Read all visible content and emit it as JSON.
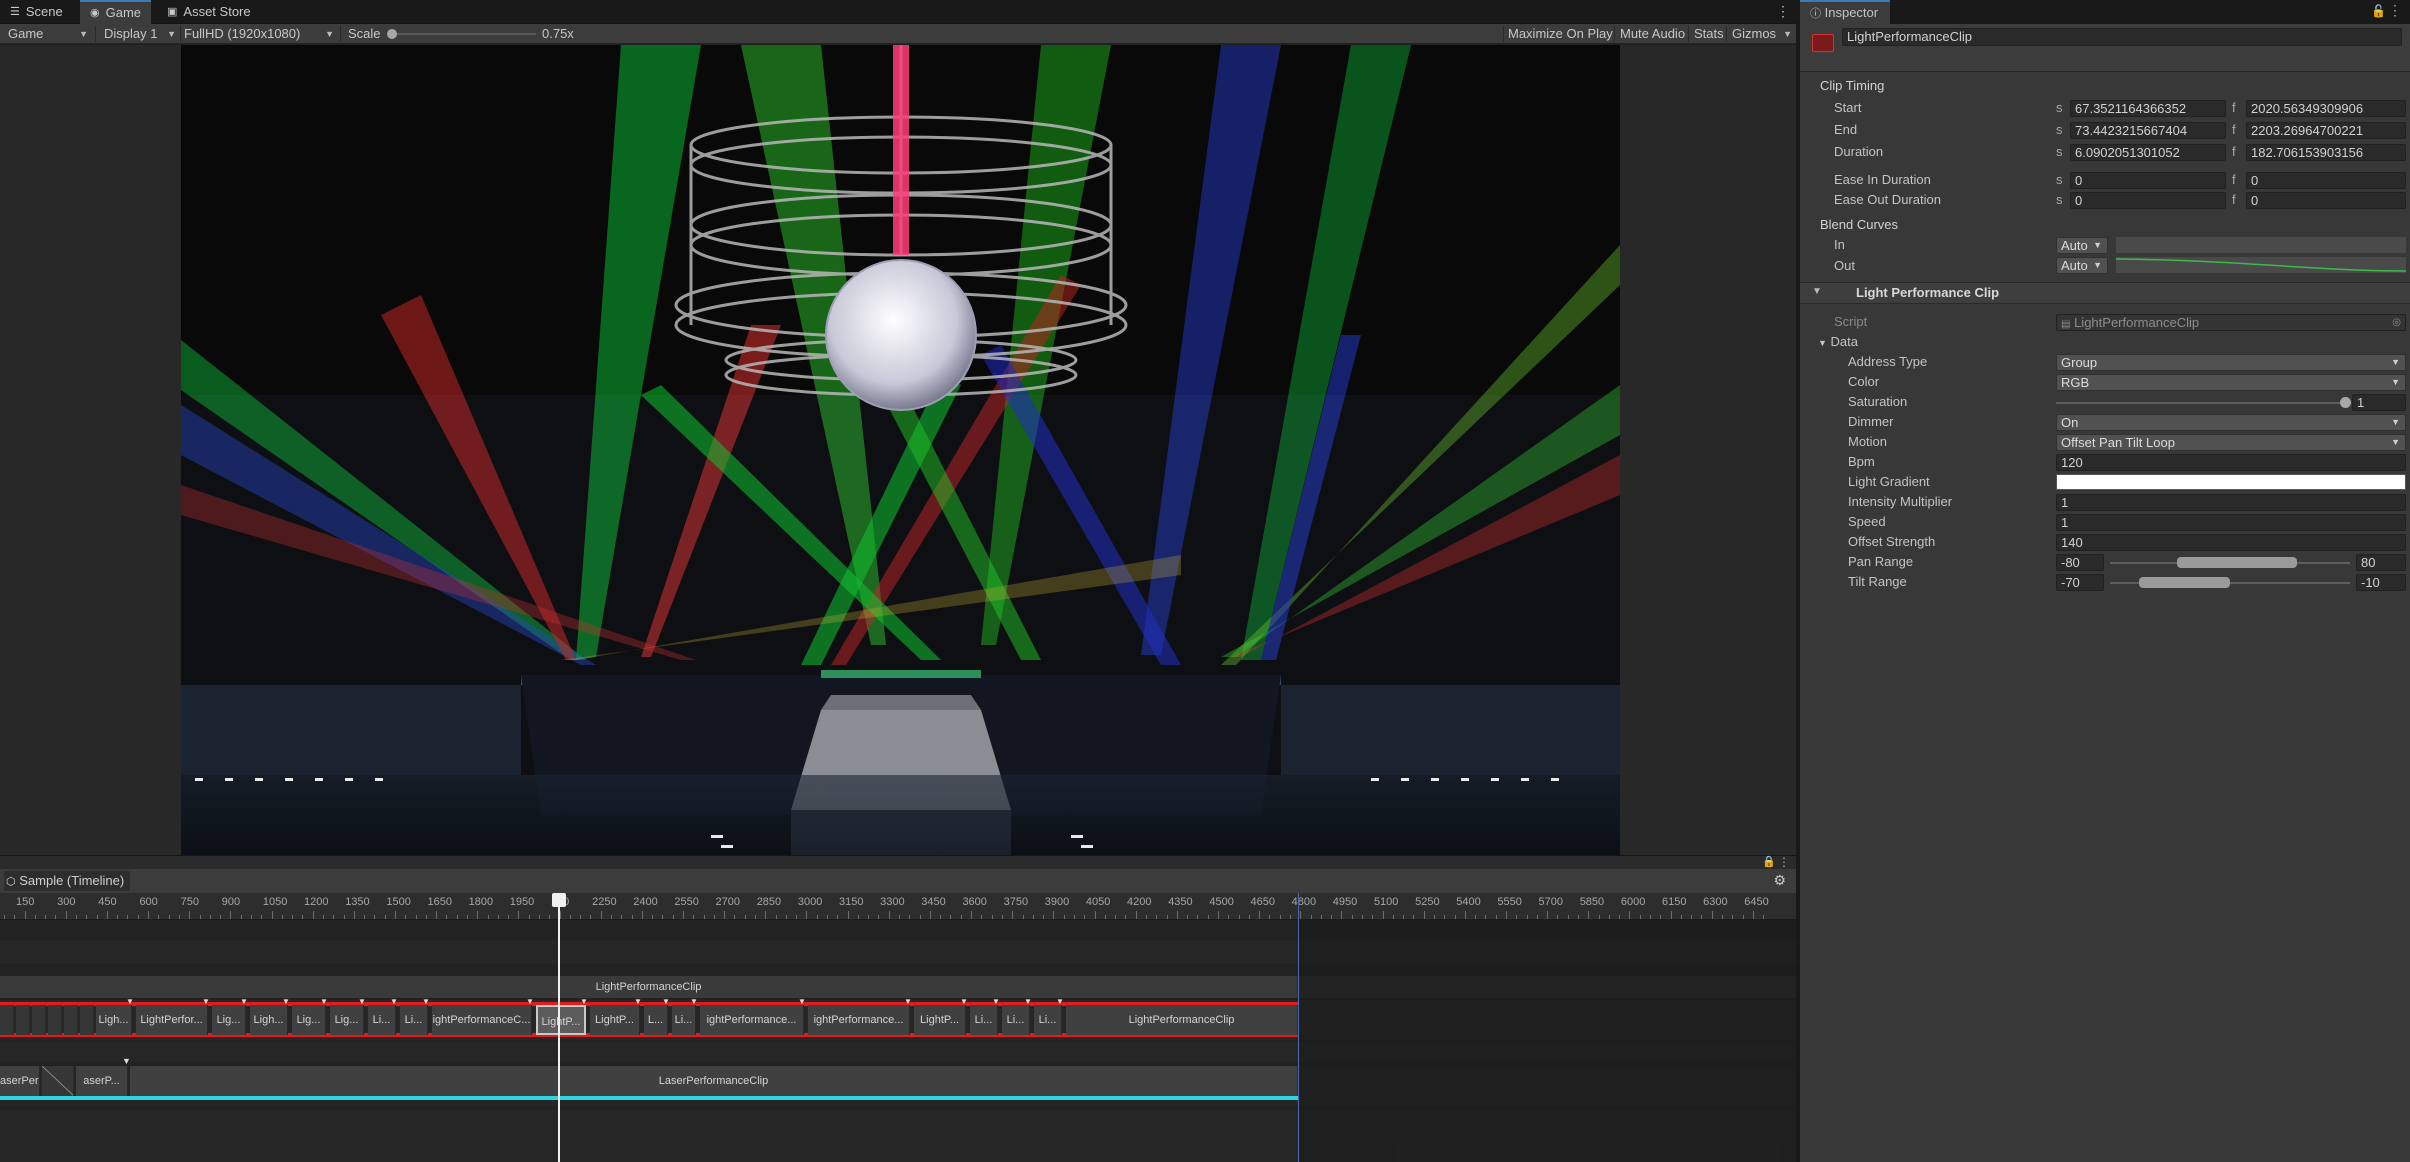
{
  "tabs": [
    {
      "label": "Scene",
      "icon": "scene-icon"
    },
    {
      "label": "Game",
      "icon": "gamepad-icon"
    },
    {
      "label": "Asset Store",
      "icon": "shopping-bag-icon"
    }
  ],
  "toolbar": {
    "view_mode": "Game",
    "display": "Display 1",
    "resolution": "FullHD (1920x1080)",
    "scale_label": "Scale",
    "scale_value": "0.75x",
    "maximize": "Maximize On Play",
    "mute": "Mute Audio",
    "stats": "Stats",
    "gizmos": "Gizmos"
  },
  "timeline": {
    "title": "Sample (Timeline)",
    "ruler_labels": [
      "150",
      "300",
      "450",
      "600",
      "750",
      "900",
      "1050",
      "1200",
      "1350",
      "1500",
      "1650",
      "1800",
      "1950",
      "100",
      "2250",
      "2400",
      "2550",
      "2700",
      "2850",
      "3000",
      "3150",
      "3300",
      "3450",
      "3600",
      "3750",
      "3900",
      "4050",
      "4200",
      "4350",
      "4500",
      "4650",
      "4800",
      "4950",
      "5100",
      "5250",
      "5400",
      "5550",
      "5700",
      "5850",
      "6000",
      "6150",
      "6300",
      "6450"
    ],
    "top_clip": "LightPerformanceClip",
    "light_clips": [
      "Ligh...",
      "LightPerfor...",
      "Lig...",
      "Ligh...",
      "Lig...",
      "Lig...",
      "Li...",
      "Li...",
      "ightPerformanceC...",
      "LightP...",
      "LightP...",
      "L...",
      "Li...",
      "ightPerformance...",
      "ightPerformance...",
      "LightP...",
      "Li...",
      "Li...",
      "Li...",
      "LightPerformanceClip"
    ],
    "laser_clips": [
      "aserPer...",
      "aserP...",
      "LaserPerformanceClip"
    ]
  },
  "inspector": {
    "tab_title": "Inspector",
    "object_name": "LightPerformanceClip",
    "clip_timing_title": "Clip Timing",
    "timing": [
      {
        "label": "Start",
        "s": "67.3521164366352",
        "f": "2020.56349309906"
      },
      {
        "label": "End",
        "s": "73.4423215667404",
        "f": "2203.26964700221"
      },
      {
        "label": "Duration",
        "s": "6.0902051301052",
        "f": "182.706153903156"
      },
      {
        "label": "Ease In Duration",
        "s": "0",
        "f": "0"
      },
      {
        "label": "Ease Out Duration",
        "s": "0",
        "f": "0"
      }
    ],
    "s_unit": "s",
    "f_unit": "f",
    "blend_curves_title": "Blend Curves",
    "blend_in_label": "In",
    "blend_out_label": "Out",
    "blend_in_mode": "Auto",
    "blend_out_mode": "Auto",
    "component_title": "Light Performance Clip",
    "script_label": "Script",
    "script_value": "LightPerformanceClip",
    "data_label": "Data",
    "address_type": {
      "label": "Address Type",
      "value": "Group"
    },
    "color": {
      "label": "Color",
      "value": "RGB"
    },
    "saturation": {
      "label": "Saturation",
      "value": "1",
      "fraction": 1.0
    },
    "dimmer": {
      "label": "Dimmer",
      "value": "On"
    },
    "motion": {
      "label": "Motion",
      "value": "Offset Pan Tilt Loop"
    },
    "bpm": {
      "label": "Bpm",
      "value": "120"
    },
    "light_gradient": {
      "label": "Light Gradient"
    },
    "intensity": {
      "label": "Intensity Multiplier",
      "value": "1"
    },
    "speed": {
      "label": "Speed",
      "value": "1"
    },
    "offset_strength": {
      "label": "Offset Strength",
      "value": "140"
    },
    "pan_range": {
      "label": "Pan Range",
      "min": "-80",
      "max": "80"
    },
    "tilt_range": {
      "label": "Tilt Range",
      "min": "-70",
      "max": "-10"
    }
  },
  "colors": {
    "accent": "#3a79bb",
    "timeline_red": "#e31b1b",
    "timeline_cyan": "#2fd6e0"
  }
}
